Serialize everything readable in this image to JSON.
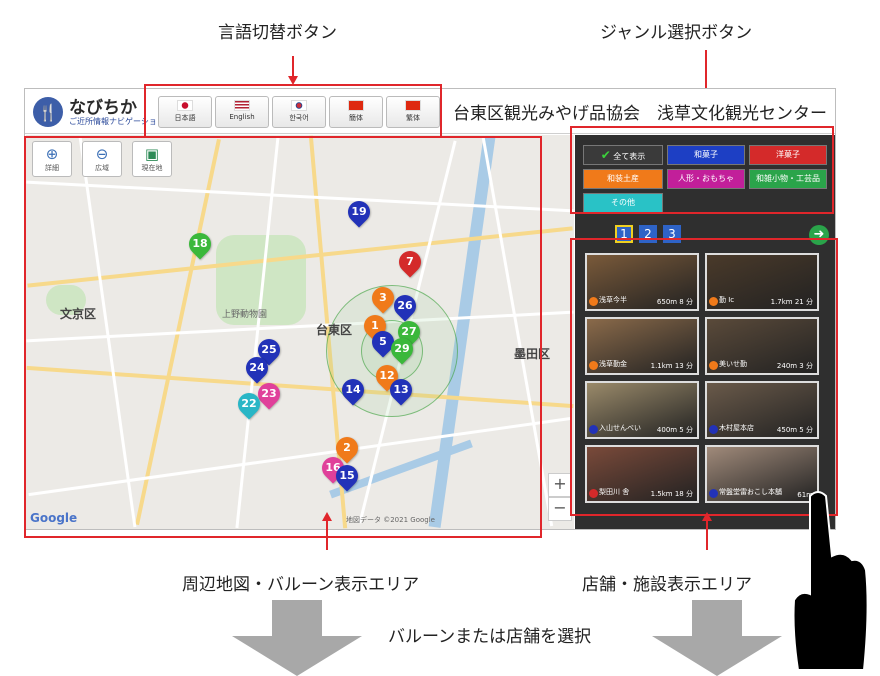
{
  "annotations": {
    "lang_switch": "言語切替ボタン",
    "genre_select": "ジャンル選択ボタン",
    "map_area": "周辺地図・バルーン表示エリア",
    "shop_area": "店舗・施設表示エリア",
    "select_hint": "バルーンまたは店舗を選択"
  },
  "header": {
    "logo_title": "なびちか",
    "logo_sub": "ご近所情報ナビゲーション",
    "org_title": "台東区観光みやげ品協会　浅草文化観光センター"
  },
  "languages": [
    {
      "label": "日本語",
      "flag": "japan-flag-icon"
    },
    {
      "label": "English",
      "flag": "us-flag-icon"
    },
    {
      "label": "한국어",
      "flag": "korea-flag-icon"
    },
    {
      "label": "簡体",
      "flag": "china-flag-icon"
    },
    {
      "label": "繁体",
      "flag": "china-flag-icon"
    }
  ],
  "map_tools": [
    {
      "label": "詳細",
      "icon": "zoom-in-icon"
    },
    {
      "label": "広域",
      "icon": "zoom-out-icon"
    },
    {
      "label": "現在地",
      "icon": "location-icon"
    }
  ],
  "map_labels": {
    "bunkyo": "文京区",
    "taito": "台東区",
    "sumida": "墨田区",
    "ueno": "上野動物園",
    "google": "Google",
    "attribution": "地図データ ©2021 Google"
  },
  "balloons": [
    {
      "n": "19",
      "color": "#2232b8"
    },
    {
      "n": "18",
      "color": "#3bb83b"
    },
    {
      "n": "7",
      "color": "#d42a2a"
    },
    {
      "n": "3",
      "color": "#f07a1a"
    },
    {
      "n": "26",
      "color": "#2232b8"
    },
    {
      "n": "1",
      "color": "#f07a1a"
    },
    {
      "n": "27",
      "color": "#3bb83b"
    },
    {
      "n": "5",
      "color": "#2232b8"
    },
    {
      "n": "29",
      "color": "#3bb83b"
    },
    {
      "n": "25",
      "color": "#2232b8"
    },
    {
      "n": "24",
      "color": "#2232b8"
    },
    {
      "n": "14",
      "color": "#2232b8"
    },
    {
      "n": "12",
      "color": "#f07a1a"
    },
    {
      "n": "13",
      "color": "#2232b8"
    },
    {
      "n": "23",
      "color": "#e0409a"
    },
    {
      "n": "22",
      "color": "#29b6c6"
    },
    {
      "n": "2",
      "color": "#f07a1a"
    },
    {
      "n": "16",
      "color": "#e0409a"
    },
    {
      "n": "15",
      "color": "#2232b8"
    }
  ],
  "genres": [
    {
      "label": "全て表示",
      "color": "#3a3a3a"
    },
    {
      "label": "和菓子",
      "color": "#1d3fc4"
    },
    {
      "label": "洋菓子",
      "color": "#d42a2a"
    },
    {
      "label": "和装土産",
      "color": "#f07a1a"
    },
    {
      "label": "人形・おもちゃ",
      "color": "#c21f9a"
    },
    {
      "label": "和雑小物・工芸品",
      "color": "#2aa44a"
    },
    {
      "label": "その他",
      "color": "#29c2c6"
    }
  ],
  "pages": [
    "1",
    "2",
    "3"
  ],
  "shops": [
    {
      "name": "浅草今半",
      "dist": "650m 8 分",
      "color": "#f07a1a",
      "img": "#7a5a3a"
    },
    {
      "name": "勤 Ic",
      "dist": "1.7km 21 分",
      "color": "#f07a1a",
      "img": "#4a3a2a"
    },
    {
      "name": "浅草勤金",
      "dist": "1.1km 13 分",
      "color": "#f07a1a",
      "img": "#8a6a4a"
    },
    {
      "name": "美いせ勤",
      "dist": "240m 3 分",
      "color": "#f07a1a",
      "img": "#5a4a3a"
    },
    {
      "name": "入山せんべい",
      "dist": "400m 5 分",
      "color": "#2232b8",
      "img": "#9a8a6a"
    },
    {
      "name": "木村屋本店",
      "dist": "450m 5 分",
      "color": "#2232b8",
      "img": "#6a5a4a"
    },
    {
      "name": "梨田川 舎",
      "dist": "1.5km 18 分",
      "color": "#d42a2a",
      "img": "#7a4a3a"
    },
    {
      "name": "常盤堂雷おこし本舗",
      "dist": "61m",
      "color": "#2232b8",
      "img": "#a08a7a"
    }
  ]
}
